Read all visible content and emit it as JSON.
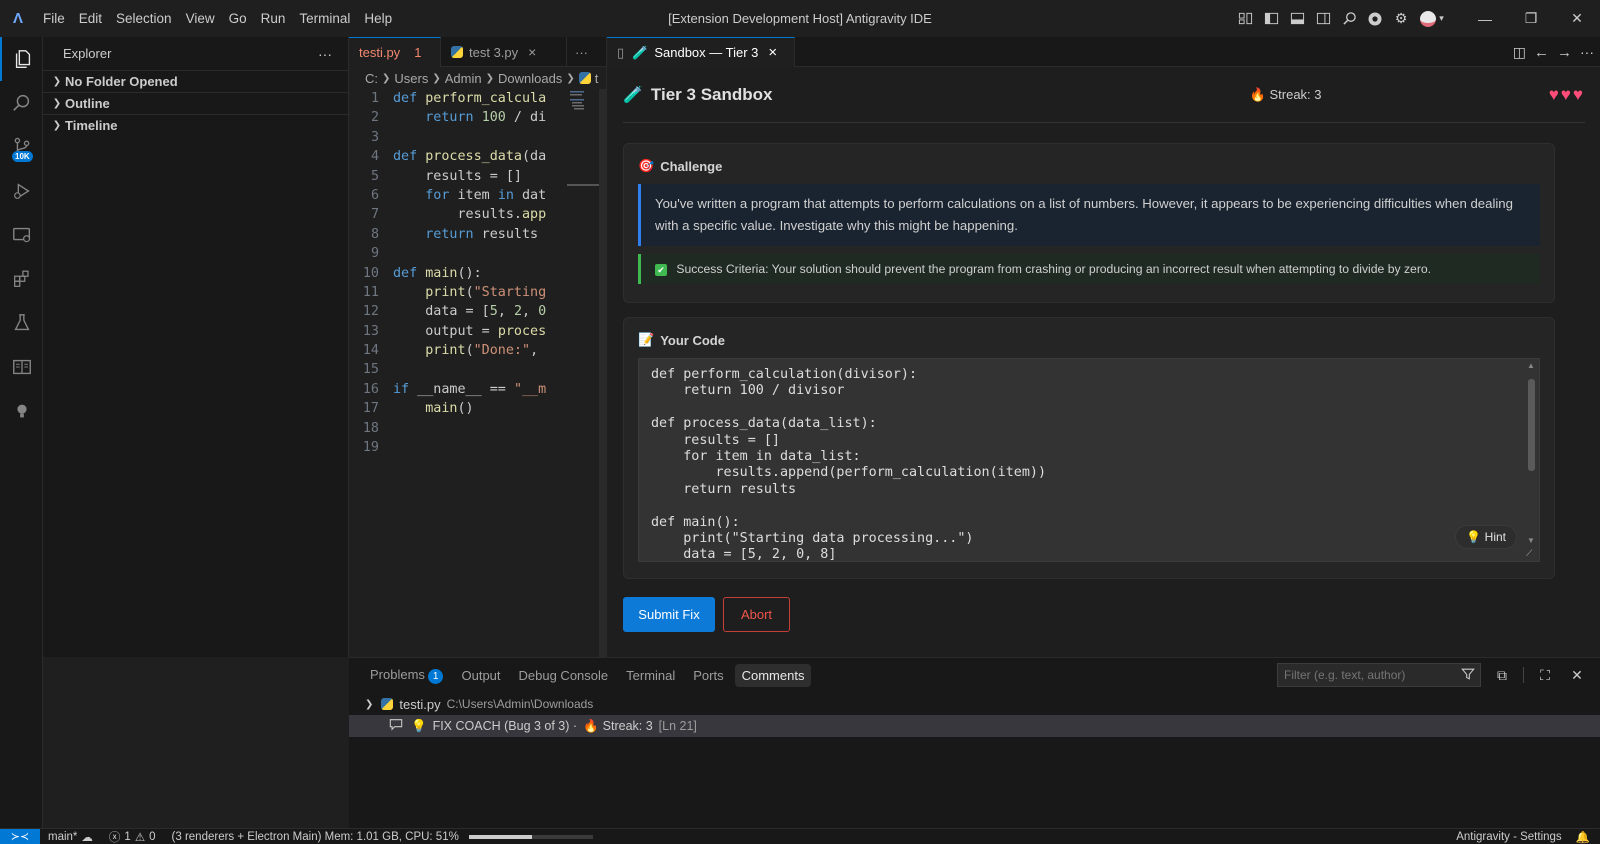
{
  "titlebar": {
    "menu": [
      "File",
      "Edit",
      "Selection",
      "View",
      "Go",
      "Run",
      "Terminal",
      "Help"
    ],
    "window_title": "[Extension Development Host] Antigravity IDE"
  },
  "activity": {
    "scm_badge": "10K"
  },
  "sidebar": {
    "title": "Explorer",
    "more": "···",
    "sections": [
      "No Folder Opened",
      "Outline",
      "Timeline"
    ]
  },
  "editor": {
    "tabs": [
      {
        "label": "testi.py",
        "problems": "1"
      },
      {
        "label": "test 3.py",
        "close": "×"
      }
    ],
    "tabs_more": "···",
    "breadcrumb": [
      "C:",
      "Users",
      "Admin",
      "Downloads",
      "t"
    ],
    "lines": [
      {
        "n": "1",
        "code": "def perform_calcula"
      },
      {
        "n": "2",
        "code": "    return 100 / di"
      },
      {
        "n": "3",
        "code": ""
      },
      {
        "n": "4",
        "code": "def process_data(da"
      },
      {
        "n": "5",
        "code": "    results = []"
      },
      {
        "n": "6",
        "code": "    for item in dat"
      },
      {
        "n": "7",
        "code": "        results.app"
      },
      {
        "n": "8",
        "code": "    return results"
      },
      {
        "n": "9",
        "code": ""
      },
      {
        "n": "10",
        "code": "def main():"
      },
      {
        "n": "11",
        "code": "    print(\"Starting"
      },
      {
        "n": "12",
        "code": "    data = [5, 2, 0"
      },
      {
        "n": "13",
        "code": "    output = proces"
      },
      {
        "n": "14",
        "code": "    print(\"Done:\","
      },
      {
        "n": "15",
        "code": ""
      },
      {
        "n": "16",
        "code": "if __name__ == \"__m"
      },
      {
        "n": "17",
        "code": "    main()"
      },
      {
        "n": "18",
        "code": ""
      },
      {
        "n": "19",
        "code": ""
      }
    ]
  },
  "sandbox": {
    "tab_label": "Sandbox — Tier 3",
    "tab_close": "×",
    "title": "Tier 3 Sandbox",
    "streak": "Streak: 3",
    "hearts": "♥♥♥",
    "challenge_title": "Challenge",
    "challenge_text": "You've written a program that attempts to perform calculations on a list of numbers. However, it appears to be experiencing difficulties when dealing with a specific value. Investigate why this might be happening.",
    "criteria_text": "Success Criteria: Your solution should prevent the program from crashing or producing an incorrect result when attempting to divide by zero.",
    "code_title": "Your Code",
    "code": "def perform_calculation(divisor):\n    return 100 / divisor\n\ndef process_data(data_list):\n    results = []\n    for item in data_list:\n        results.append(perform_calculation(item))\n    return results\n\ndef main():\n    print(\"Starting data processing...\")\n    data = [5, 2, 0, 8]",
    "hint_label": "Hint",
    "submit_label": "Submit Fix",
    "abort_label": "Abort"
  },
  "panel": {
    "tabs": [
      "Problems",
      "Output",
      "Debug Console",
      "Terminal",
      "Ports",
      "Comments"
    ],
    "problems_badge": "1",
    "filter_placeholder": "Filter (e.g. text, author)",
    "file_name": "testi.py",
    "file_path": "C:\\Users\\Admin\\Downloads",
    "comment_text": "FIX COACH (Bug 3 of 3) ·",
    "comment_streak": "Streak: 3",
    "comment_line": "[Ln 21]"
  },
  "statusbar": {
    "branch": "main*",
    "errors": "1",
    "warnings": "0",
    "process_info": "(3 renderers + Electron Main) Mem: 1.01 GB, CPU: 51%",
    "mem_fraction": 0.51,
    "right_label": "Antigravity - Settings"
  },
  "colors": {
    "accent": "#0078d4",
    "submit": "#0e7ad8",
    "abort": "#f0554c",
    "hearts": "#ff4d7a",
    "criteria_border": "#3fb950"
  }
}
